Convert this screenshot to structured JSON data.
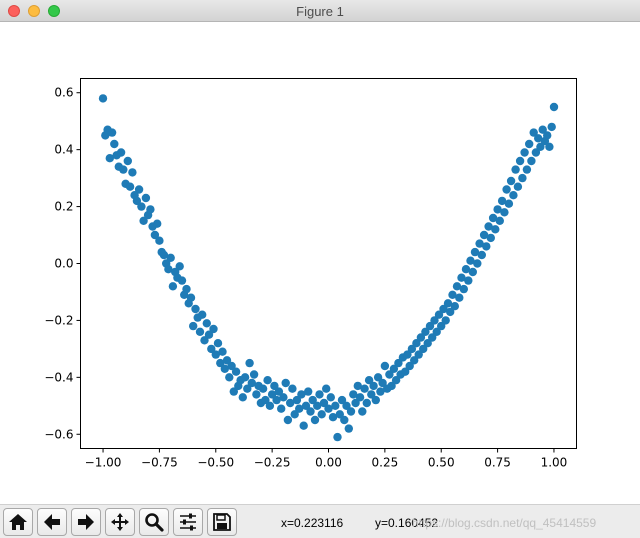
{
  "window": {
    "title": "Figure 1"
  },
  "toolbar": {
    "buttons": [
      {
        "name": "home-button",
        "icon": "home-icon"
      },
      {
        "name": "back-button",
        "icon": "arrow-left-icon"
      },
      {
        "name": "forward-button",
        "icon": "arrow-right-icon"
      },
      {
        "name": "pan-button",
        "icon": "move-icon"
      },
      {
        "name": "zoom-button",
        "icon": "magnifier-icon"
      },
      {
        "name": "subplots-button",
        "icon": "sliders-icon"
      },
      {
        "name": "save-button",
        "icon": "floppy-icon"
      }
    ],
    "x_readout": "x=0.223116",
    "y_readout": "y=0.160452"
  },
  "watermark": "https://blog.csdn.net/qq_45414559",
  "chart_data": {
    "type": "scatter",
    "title": "",
    "xlabel": "",
    "ylabel": "",
    "xlim": [
      -1.1,
      1.1
    ],
    "ylim": [
      -0.65,
      0.65
    ],
    "xticks": [
      -1.0,
      -0.75,
      -0.5,
      -0.25,
      0.0,
      0.25,
      0.5,
      0.75,
      1.0
    ],
    "xtick_labels": [
      "−1.00",
      "−0.75",
      "−0.50",
      "−0.25",
      "0.00",
      "0.25",
      "0.50",
      "0.75",
      "1.00"
    ],
    "yticks": [
      -0.6,
      -0.4,
      -0.2,
      0.0,
      0.2,
      0.4,
      0.6
    ],
    "ytick_labels": [
      "−0.6",
      "−0.4",
      "−0.2",
      "0.0",
      "0.2",
      "0.4",
      "0.6"
    ],
    "grid": false,
    "marker_color": "#1f7bb6",
    "points": [
      [
        -1.0,
        0.58
      ],
      [
        -0.99,
        0.45
      ],
      [
        -0.98,
        0.47
      ],
      [
        -0.97,
        0.37
      ],
      [
        -0.96,
        0.46
      ],
      [
        -0.95,
        0.42
      ],
      [
        -0.94,
        0.38
      ],
      [
        -0.93,
        0.34
      ],
      [
        -0.92,
        0.39
      ],
      [
        -0.91,
        0.33
      ],
      [
        -0.9,
        0.28
      ],
      [
        -0.89,
        0.36
      ],
      [
        -0.88,
        0.27
      ],
      [
        -0.87,
        0.32
      ],
      [
        -0.86,
        0.24
      ],
      [
        -0.85,
        0.22
      ],
      [
        -0.84,
        0.26
      ],
      [
        -0.83,
        0.2
      ],
      [
        -0.82,
        0.15
      ],
      [
        -0.81,
        0.23
      ],
      [
        -0.8,
        0.17
      ],
      [
        -0.79,
        0.19
      ],
      [
        -0.78,
        0.13
      ],
      [
        -0.77,
        0.1
      ],
      [
        -0.76,
        0.14
      ],
      [
        -0.75,
        0.08
      ],
      [
        -0.74,
        0.04
      ],
      [
        -0.73,
        0.03
      ],
      [
        -0.72,
        0.0
      ],
      [
        -0.71,
        -0.02
      ],
      [
        -0.7,
        0.02
      ],
      [
        -0.69,
        -0.08
      ],
      [
        -0.68,
        -0.03
      ],
      [
        -0.67,
        -0.05
      ],
      [
        -0.66,
        -0.01
      ],
      [
        -0.65,
        -0.06
      ],
      [
        -0.64,
        -0.11
      ],
      [
        -0.63,
        -0.09
      ],
      [
        -0.62,
        -0.14
      ],
      [
        -0.61,
        -0.12
      ],
      [
        -0.6,
        -0.22
      ],
      [
        -0.59,
        -0.16
      ],
      [
        -0.58,
        -0.19
      ],
      [
        -0.57,
        -0.24
      ],
      [
        -0.56,
        -0.18
      ],
      [
        -0.55,
        -0.27
      ],
      [
        -0.54,
        -0.21
      ],
      [
        -0.53,
        -0.25
      ],
      [
        -0.52,
        -0.3
      ],
      [
        -0.51,
        -0.23
      ],
      [
        -0.5,
        -0.32
      ],
      [
        -0.49,
        -0.28
      ],
      [
        -0.48,
        -0.35
      ],
      [
        -0.47,
        -0.31
      ],
      [
        -0.46,
        -0.37
      ],
      [
        -0.45,
        -0.34
      ],
      [
        -0.44,
        -0.4
      ],
      [
        -0.43,
        -0.36
      ],
      [
        -0.42,
        -0.45
      ],
      [
        -0.41,
        -0.38
      ],
      [
        -0.4,
        -0.43
      ],
      [
        -0.39,
        -0.41
      ],
      [
        -0.38,
        -0.47
      ],
      [
        -0.37,
        -0.4
      ],
      [
        -0.36,
        -0.44
      ],
      [
        -0.35,
        -0.35
      ],
      [
        -0.34,
        -0.42
      ],
      [
        -0.33,
        -0.39
      ],
      [
        -0.32,
        -0.46
      ],
      [
        -0.31,
        -0.43
      ],
      [
        -0.3,
        -0.49
      ],
      [
        -0.29,
        -0.44
      ],
      [
        -0.28,
        -0.48
      ],
      [
        -0.27,
        -0.41
      ],
      [
        -0.26,
        -0.5
      ],
      [
        -0.25,
        -0.46
      ],
      [
        -0.24,
        -0.43
      ],
      [
        -0.23,
        -0.48
      ],
      [
        -0.22,
        -0.45
      ],
      [
        -0.21,
        -0.51
      ],
      [
        -0.2,
        -0.47
      ],
      [
        -0.19,
        -0.42
      ],
      [
        -0.18,
        -0.55
      ],
      [
        -0.17,
        -0.49
      ],
      [
        -0.16,
        -0.44
      ],
      [
        -0.15,
        -0.53
      ],
      [
        -0.14,
        -0.48
      ],
      [
        -0.13,
        -0.51
      ],
      [
        -0.12,
        -0.46
      ],
      [
        -0.11,
        -0.57
      ],
      [
        -0.1,
        -0.5
      ],
      [
        -0.09,
        -0.45
      ],
      [
        -0.08,
        -0.52
      ],
      [
        -0.07,
        -0.48
      ],
      [
        -0.06,
        -0.55
      ],
      [
        -0.05,
        -0.5
      ],
      [
        -0.04,
        -0.46
      ],
      [
        -0.03,
        -0.53
      ],
      [
        -0.02,
        -0.49
      ],
      [
        -0.01,
        -0.44
      ],
      [
        0.0,
        -0.51
      ],
      [
        0.01,
        -0.47
      ],
      [
        0.02,
        -0.54
      ],
      [
        0.03,
        -0.5
      ],
      [
        0.04,
        -0.61
      ],
      [
        0.05,
        -0.53
      ],
      [
        0.06,
        -0.48
      ],
      [
        0.07,
        -0.55
      ],
      [
        0.08,
        -0.5
      ],
      [
        0.09,
        -0.58
      ],
      [
        0.1,
        -0.52
      ],
      [
        0.11,
        -0.46
      ],
      [
        0.12,
        -0.49
      ],
      [
        0.13,
        -0.43
      ],
      [
        0.14,
        -0.47
      ],
      [
        0.15,
        -0.52
      ],
      [
        0.16,
        -0.44
      ],
      [
        0.17,
        -0.49
      ],
      [
        0.18,
        -0.41
      ],
      [
        0.19,
        -0.46
      ],
      [
        0.2,
        -0.43
      ],
      [
        0.21,
        -0.48
      ],
      [
        0.22,
        -0.4
      ],
      [
        0.23,
        -0.45
      ],
      [
        0.24,
        -0.42
      ],
      [
        0.25,
        -0.36
      ],
      [
        0.26,
        -0.44
      ],
      [
        0.27,
        -0.39
      ],
      [
        0.28,
        -0.43
      ],
      [
        0.29,
        -0.37
      ],
      [
        0.3,
        -0.41
      ],
      [
        0.31,
        -0.35
      ],
      [
        0.32,
        -0.39
      ],
      [
        0.33,
        -0.33
      ],
      [
        0.34,
        -0.38
      ],
      [
        0.35,
        -0.32
      ],
      [
        0.36,
        -0.36
      ],
      [
        0.37,
        -0.3
      ],
      [
        0.38,
        -0.34
      ],
      [
        0.39,
        -0.28
      ],
      [
        0.4,
        -0.32
      ],
      [
        0.41,
        -0.26
      ],
      [
        0.42,
        -0.3
      ],
      [
        0.43,
        -0.24
      ],
      [
        0.44,
        -0.28
      ],
      [
        0.45,
        -0.22
      ],
      [
        0.46,
        -0.26
      ],
      [
        0.47,
        -0.2
      ],
      [
        0.48,
        -0.24
      ],
      [
        0.49,
        -0.18
      ],
      [
        0.5,
        -0.22
      ],
      [
        0.51,
        -0.16
      ],
      [
        0.52,
        -0.2
      ],
      [
        0.53,
        -0.14
      ],
      [
        0.54,
        -0.17
      ],
      [
        0.55,
        -0.11
      ],
      [
        0.56,
        -0.15
      ],
      [
        0.57,
        -0.08
      ],
      [
        0.58,
        -0.12
      ],
      [
        0.59,
        -0.05
      ],
      [
        0.6,
        -0.09
      ],
      [
        0.61,
        -0.02
      ],
      [
        0.62,
        -0.06
      ],
      [
        0.63,
        0.01
      ],
      [
        0.64,
        -0.03
      ],
      [
        0.65,
        0.04
      ],
      [
        0.66,
        0.0
      ],
      [
        0.67,
        0.07
      ],
      [
        0.68,
        0.03
      ],
      [
        0.69,
        0.1
      ],
      [
        0.7,
        0.06
      ],
      [
        0.71,
        0.13
      ],
      [
        0.72,
        0.09
      ],
      [
        0.73,
        0.16
      ],
      [
        0.74,
        0.12
      ],
      [
        0.75,
        0.19
      ],
      [
        0.76,
        0.15
      ],
      [
        0.77,
        0.22
      ],
      [
        0.78,
        0.18
      ],
      [
        0.79,
        0.26
      ],
      [
        0.8,
        0.21
      ],
      [
        0.81,
        0.29
      ],
      [
        0.82,
        0.24
      ],
      [
        0.83,
        0.33
      ],
      [
        0.84,
        0.27
      ],
      [
        0.85,
        0.36
      ],
      [
        0.86,
        0.3
      ],
      [
        0.87,
        0.39
      ],
      [
        0.88,
        0.33
      ],
      [
        0.89,
        0.42
      ],
      [
        0.9,
        0.36
      ],
      [
        0.91,
        0.46
      ],
      [
        0.92,
        0.39
      ],
      [
        0.93,
        0.44
      ],
      [
        0.94,
        0.41
      ],
      [
        0.95,
        0.47
      ],
      [
        0.96,
        0.43
      ],
      [
        0.97,
        0.45
      ],
      [
        0.98,
        0.41
      ],
      [
        0.99,
        0.48
      ],
      [
        1.0,
        0.55
      ]
    ]
  }
}
